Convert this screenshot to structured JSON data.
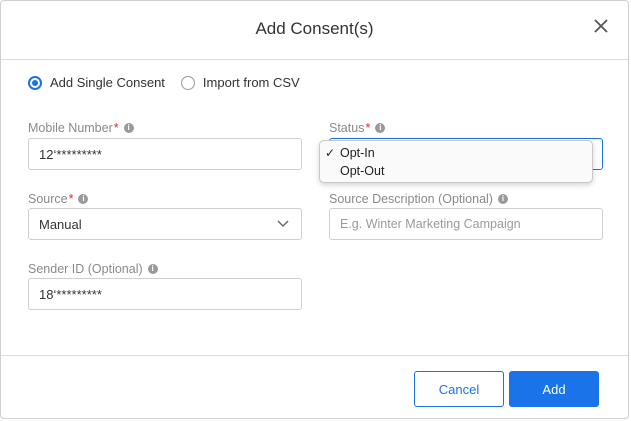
{
  "dialog": {
    "title": "Add Consent(s)"
  },
  "mode": {
    "options": [
      "Add Single Consent",
      "Import from CSV"
    ],
    "selected": "Add Single Consent"
  },
  "mobile": {
    "label": "Mobile Number",
    "value": "12‘*********"
  },
  "status": {
    "label": "Status",
    "options": [
      "Opt-In",
      "Opt-Out"
    ],
    "selected": "Opt-In"
  },
  "source": {
    "label": "Source",
    "value": "Manual"
  },
  "source_description": {
    "label": "Source Description (Optional)",
    "placeholder": "E.g. Winter Marketing Campaign"
  },
  "sender": {
    "label": "Sender ID (Optional)",
    "value": "18‘*********"
  },
  "buttons": {
    "cancel": "Cancel",
    "add": "Add"
  },
  "colors": {
    "accent": "#1a73e8",
    "required": "#d92b2b"
  }
}
